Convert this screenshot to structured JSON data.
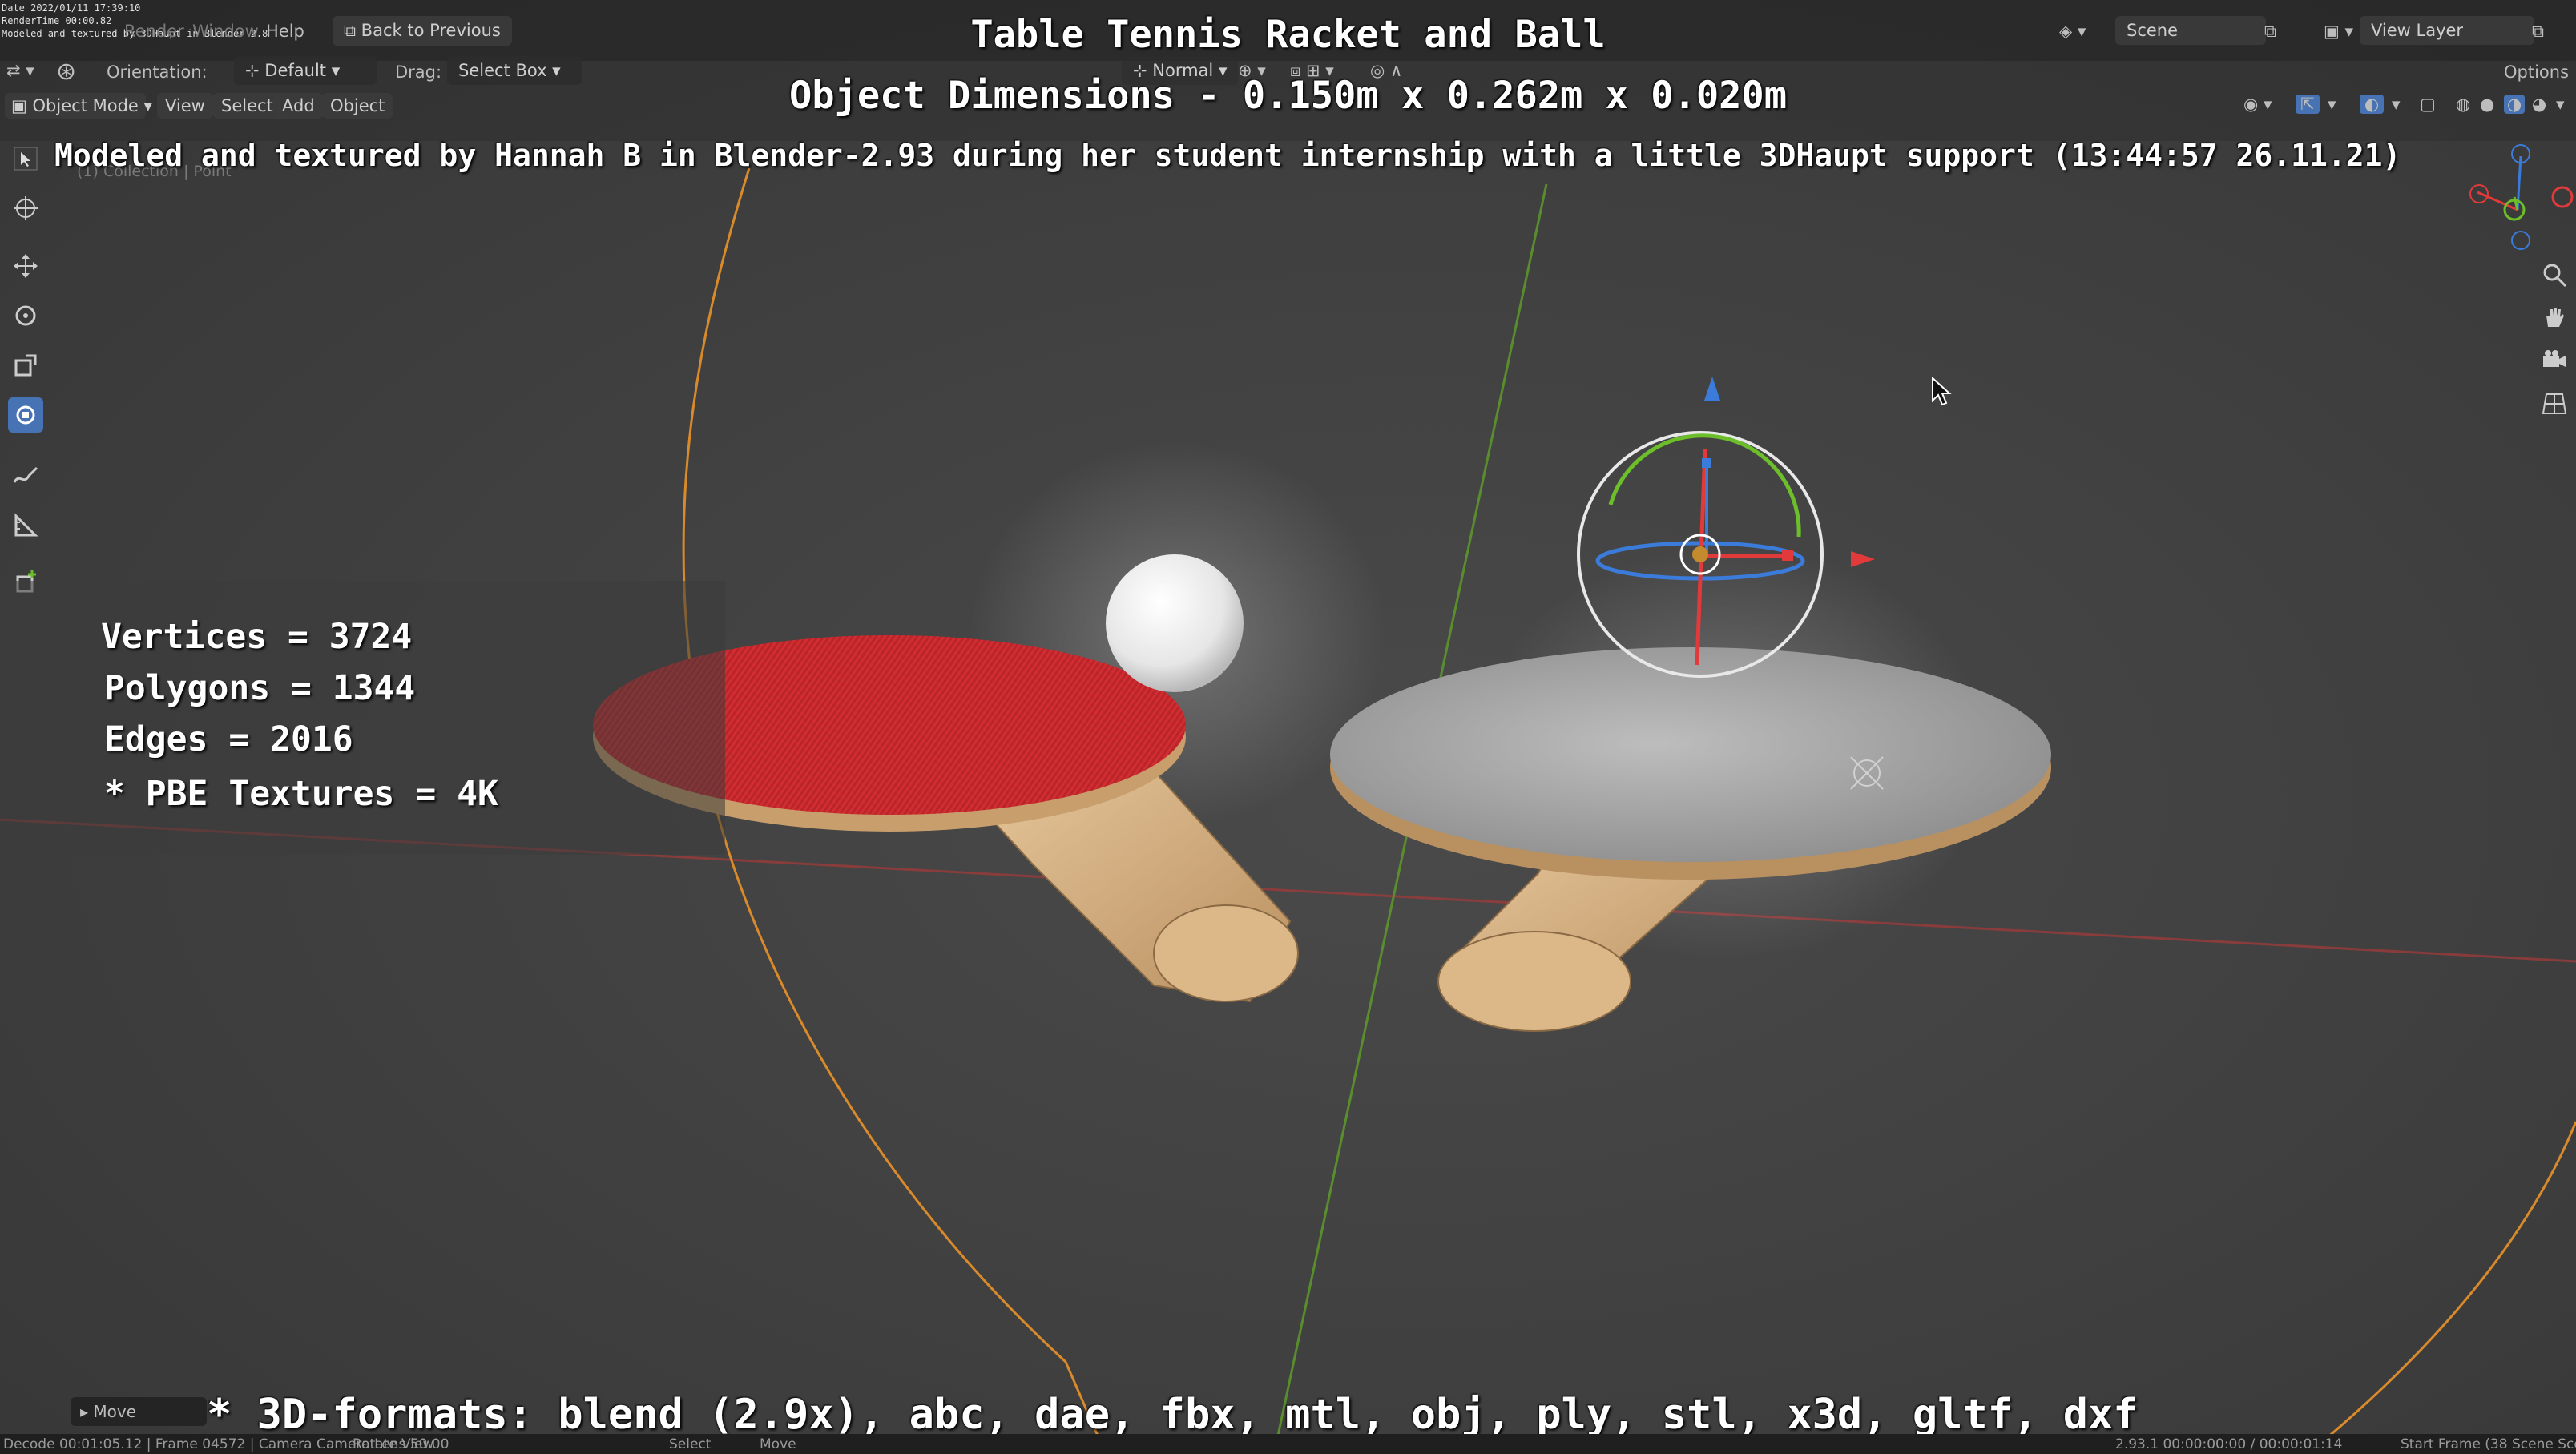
{
  "tiny_info": {
    "line1": "Date 2022/01/11 17:39:10",
    "line2": "RenderTime 00:00.82",
    "line3": "Modeled and textured by 3DHaupt in Blender-2.8"
  },
  "topbar": {
    "menus": [
      "Render",
      "Window",
      "Help"
    ],
    "back_button": "Back to Previous",
    "scene_label": "Scene",
    "view_layer_label": "View Layer"
  },
  "toolbar": {
    "orientation_label": "Orientation:",
    "orientation_value": "Default",
    "drag_label": "Drag:",
    "drag_value": "Select Box",
    "transform_pivot": "Normal",
    "options_label": "Options"
  },
  "header": {
    "mode": "Object Mode",
    "menus": [
      "View",
      "Select",
      "Add",
      "Object"
    ],
    "collection_info": "(1) Collection | Point"
  },
  "overlay": {
    "title": "Table Tennis Racket and Ball",
    "dimensions": "Object Dimensions -  0.150m x 0.262m x 0.020m",
    "credit": "Modeled and textured by Hannah B in Blender-2.93 during her student internship with a little 3DHaupt support (13:44:57 26.11.21)",
    "formats": "* 3D-formats: blend (2.9x), abc, dae, fbx, mtl, obj, ply, stl, x3d, gltf, dxf"
  },
  "stats": {
    "vertices": "Vertices = 3724",
    "polygons": "Polygons = 1344",
    "edges": "Edges = 2016",
    "textures": "* PBE Textures = 4K"
  },
  "last_operator": "Move",
  "statusbar": {
    "left_info": "Decode 00:01:05.12 | Frame 04572 | Camera Camera  Lens 50.00",
    "rotate_view": "Rotate View",
    "select": "Select",
    "move": "Move",
    "version_info": "2.93.1  00:00:00:00 / 00:00:01:14",
    "start_frame": "Start Frame (38",
    "scene": "Scene  Scene"
  },
  "colors": {
    "viewport_bg": "#414141",
    "active_tool": "#4772b3",
    "racket_red": "#c8262b",
    "axis_x": "#e23a3a",
    "axis_y": "#6cbf2a",
    "axis_z": "#3b7bd9",
    "orbit_orange": "#d98a2b"
  }
}
